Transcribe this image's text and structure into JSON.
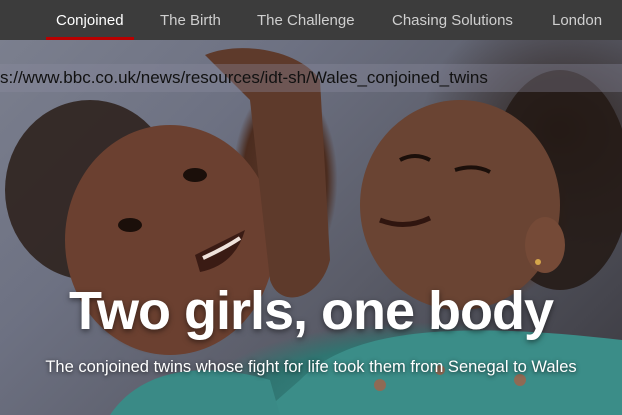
{
  "nav": {
    "items": [
      {
        "label": "Conjoined",
        "active": true
      },
      {
        "label": "The Birth"
      },
      {
        "label": "The Challenge"
      },
      {
        "label": "Chasing Solutions"
      },
      {
        "label": "London"
      }
    ],
    "accent_color": "#b80000"
  },
  "url_overlay": {
    "text": "s://www.bbc.co.uk/news/resources/idt-sh/Wales_conjoined_twins"
  },
  "hero": {
    "title": "Two girls, one body",
    "subtitle": "The conjoined twins whose fight for life took them from Senegal to Wales"
  }
}
